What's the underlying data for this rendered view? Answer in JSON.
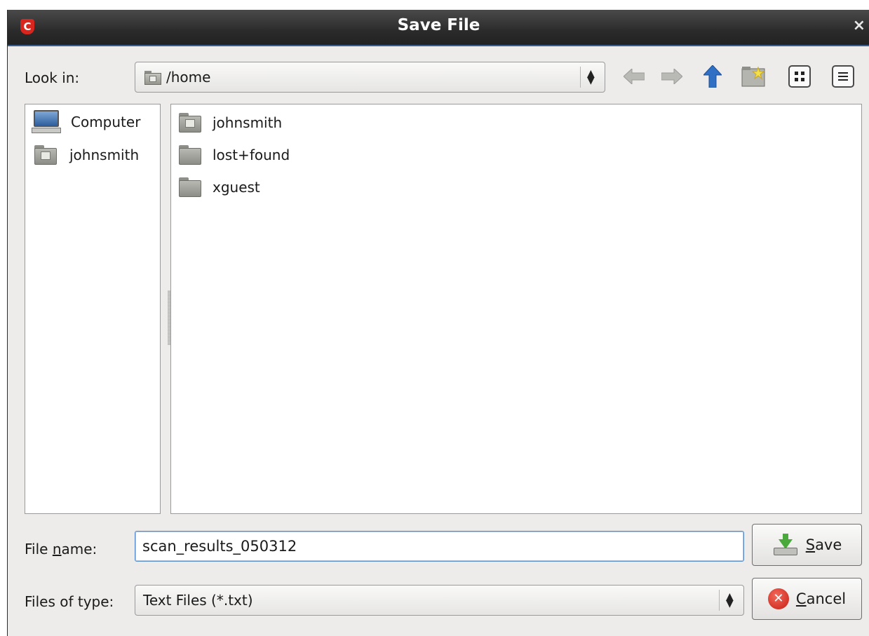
{
  "window": {
    "title": "Save File",
    "close_glyph": "×",
    "app_icon_letter": "C"
  },
  "toolbar": {
    "look_in_label": "Look in:",
    "path": "/home",
    "icons": [
      "back-arrow-icon",
      "forward-arrow-icon",
      "up-folder-icon",
      "new-folder-icon",
      "icon-view-icon",
      "list-view-icon"
    ]
  },
  "places": [
    {
      "label": "Computer",
      "icon": "computer-icon"
    },
    {
      "label": "johnsmith",
      "icon": "home-folder-icon"
    }
  ],
  "files": [
    {
      "label": "johnsmith",
      "icon": "home-folder-icon"
    },
    {
      "label": "lost+found",
      "icon": "folder-icon"
    },
    {
      "label": "xguest",
      "icon": "folder-icon"
    }
  ],
  "form": {
    "file_name_label_pre": "File ",
    "file_name_label_mnemonic": "n",
    "file_name_label_post": "ame:",
    "file_name_value": "scan_results_050312",
    "files_of_type_label": "Files of type:",
    "files_of_type_value": "Text Files (*.txt)"
  },
  "buttons": {
    "save_mnemonic": "S",
    "save_rest": "ave",
    "cancel_mnemonic": "C",
    "cancel_rest": "ancel"
  },
  "colors": {
    "titlebar": "#2b2b2b",
    "accent_blue": "#3a78c8",
    "dialog_bg": "#edeceb"
  }
}
